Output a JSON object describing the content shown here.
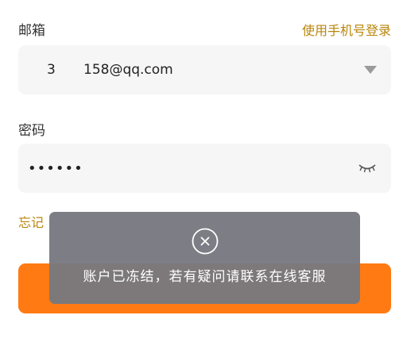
{
  "email": {
    "label": "邮箱",
    "value_prefix": "3",
    "value": "158@qq.com"
  },
  "phone_login_link": "使用手机号登录",
  "password": {
    "label": "密码",
    "value": "••••••"
  },
  "forgot_link": "忘记",
  "login_button": {
    "color": "#ff7a12"
  },
  "toast": {
    "message": "账户已冻结，若有疑问请联系在线客服",
    "icon": "close-circle-icon"
  },
  "colors": {
    "accent_text": "#b8860b",
    "input_bg": "#f6f6f7",
    "toast_bg": "#78797f"
  }
}
